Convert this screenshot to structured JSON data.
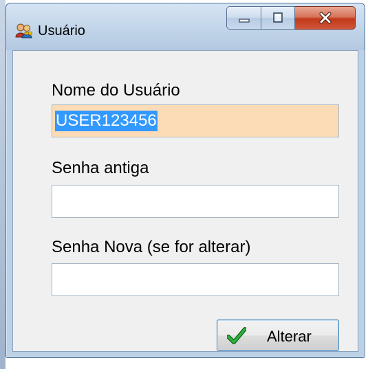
{
  "window": {
    "title": "Usuário",
    "icon": "users-key-icon"
  },
  "title_controls": {
    "minimize_icon": "minimize-icon",
    "maximize_icon": "maximize-icon",
    "close_icon": "close-icon"
  },
  "form": {
    "username_label": "Nome do Usuário",
    "username_value": "USER123456",
    "old_password_label": "Senha antiga",
    "old_password_value": "",
    "new_password_label": "Senha Nova (se for alterar)",
    "new_password_value": ""
  },
  "actions": {
    "change_label": "Alterar",
    "change_icon": "checkmark-icon"
  },
  "colors": {
    "focused_field_bg": "#fbdcb6",
    "selection_bg": "#3399ff",
    "close_button": "#c1391a",
    "checkmark": "#1f9a2a"
  }
}
